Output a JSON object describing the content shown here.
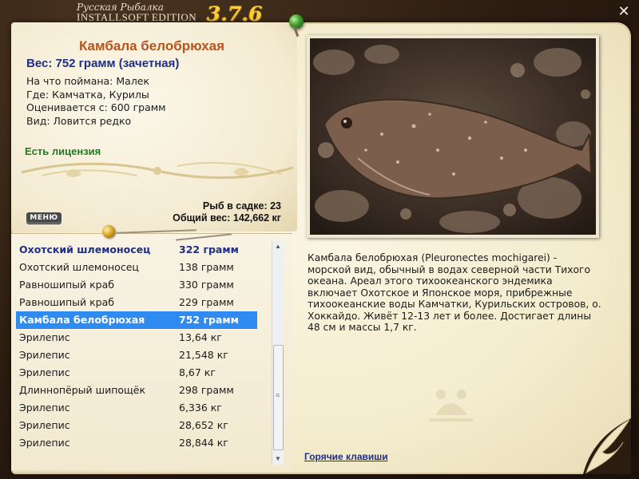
{
  "brand": {
    "subtitle": "Русская Рыбалка",
    "edition": "INSTALLSOFT EDITION",
    "version": "3.7.6"
  },
  "fish": {
    "name": "Камбала белобрюхая",
    "weight": "Вес: 752 грамм (зачетная)",
    "bait": "На что поймана: Малек",
    "place": "Где: Камчатка, Курилы",
    "rated": "Оценивается с: 600 грамм",
    "kind": "Вид: Ловится редко",
    "license": "Есть лицензия"
  },
  "stats": {
    "count": "Рыб в садке: 23",
    "total": "Общий вес: 142,662 кг"
  },
  "menu_label": "МЕНЮ",
  "catch_list": [
    {
      "name": "Охотский шлемоносец",
      "weight": "322 грамм",
      "style": "bold"
    },
    {
      "name": "Охотский шлемоносец",
      "weight": "138 грамм",
      "style": ""
    },
    {
      "name": "Равношипый краб",
      "weight": "330 грамм",
      "style": ""
    },
    {
      "name": "Равношипый краб",
      "weight": "229 грамм",
      "style": ""
    },
    {
      "name": "Камбала белобрюхая",
      "weight": "752 грамм",
      "style": "sel"
    },
    {
      "name": "Эрилепис",
      "weight": "13,64 кг",
      "style": ""
    },
    {
      "name": "Эрилепис",
      "weight": "21,548 кг",
      "style": ""
    },
    {
      "name": "Эрилепис",
      "weight": "8,67 кг",
      "style": ""
    },
    {
      "name": "Длиннопёрый шипощёк",
      "weight": "298 грамм",
      "style": ""
    },
    {
      "name": "Эрилепис",
      "weight": "6,336 кг",
      "style": ""
    },
    {
      "name": "Эрилепис",
      "weight": "28,652 кг",
      "style": ""
    },
    {
      "name": "Эрилепис",
      "weight": "28,844 кг",
      "style": ""
    }
  ],
  "description": "Камбала белобрюхая (Pleuronectes mochigarei) - морской вид, обычный в водах северной части Тихого океана. Ареал этого тихоокеанского эндемика включает Охотское и Японское моря, прибрежные тихоокеанские воды Камчатки, Курильских островов, о. Хоккайдо. Живёт 12-13 лет и более. Достигает длины 48 см и массы 1,7 кг.",
  "hotkeys": "Горячие клавиши",
  "icons": {
    "close": "close-icon",
    "pin": "pin-icon",
    "scroll_up": "scroll-up-icon",
    "scroll_down": "scroll-down-icon"
  },
  "colors": {
    "title": "#b8531c",
    "accent_blue": "#1f2f84",
    "license_green": "#1f7a20",
    "selection": "#2f8bf0",
    "version_gold": "#f7cf3c"
  }
}
